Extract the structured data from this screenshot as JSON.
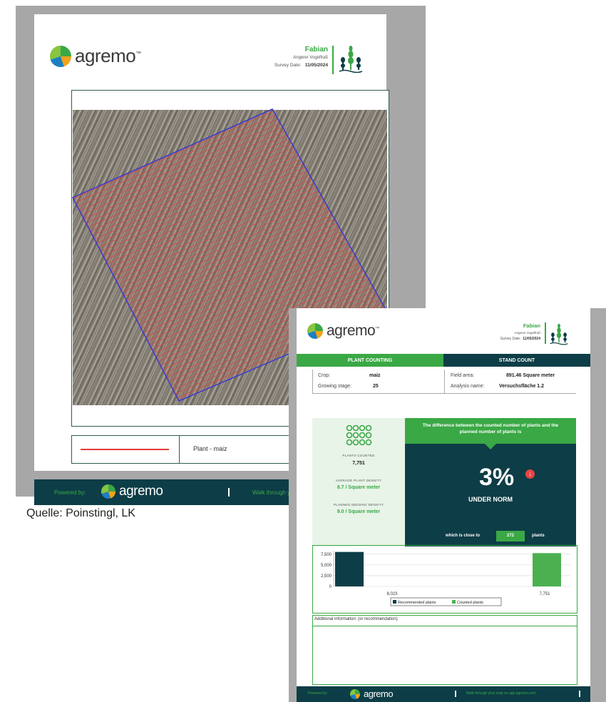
{
  "doc1": {
    "logo_text": "agremo",
    "logo_tm": "™",
    "header": {
      "name": "Fabian",
      "subtitle": "Angerer Vogelfraß",
      "survey_label": "Survey Date:",
      "survey_date": "11/05/2024"
    },
    "legend_label": "Plant - maiz",
    "footer": {
      "powered_by": "Powered by:",
      "logo_text": "agremo",
      "walk": "Walk through your"
    }
  },
  "caption": "Quelle: Poinstingl, LK",
  "doc2": {
    "logo_text": "agremo",
    "logo_tm": "™",
    "header": {
      "name": "Fabian",
      "subtitle": "Angerer Vogelfraß",
      "survey_label": "Survey Date:",
      "survey_date": "11/05/2024"
    },
    "tabs": [
      "PLANT COUNTING",
      "STAND COUNT"
    ],
    "info": {
      "crop_label": "Crop:",
      "crop_value": "maiz",
      "stage_label": "Growing stage:",
      "stage_value": "25",
      "area_label": "Field area:",
      "area_value": "891.46 Square meter",
      "analysis_label": "Analysis name:",
      "analysis_value": "Versuchsfläche 1.2"
    },
    "stats": {
      "plants_counted_label": "PLANTS COUNTED",
      "plants_counted_value": "7,751",
      "avg_density_label": "AVERAGE PLANT DENSITY",
      "avg_density_value": "8.7 / Square meter",
      "planned_density_label": "PLANNED SEEDING DENSITY",
      "planned_density_value": "9.0 / Square meter"
    },
    "difference": {
      "banner": "The difference between the counted number of plants and the planned number of plants is",
      "percent": "3%",
      "status": "UNDER NORM",
      "close_prefix": "which is close to",
      "close_value": "272",
      "close_suffix": "plants"
    },
    "additional_info": "Additional information: (or recommendation)",
    "footer": {
      "powered_by": "Powered by:",
      "logo_text": "agremo",
      "walk": "Walk through your map on app.agremo.com"
    }
  },
  "colors": {
    "green": "#3aa845",
    "navy": "#0d3d46",
    "red": "#e23a3a",
    "field_outline": "#3a3ad0"
  },
  "chart_data": {
    "type": "bar",
    "categories": [
      "8,023",
      "7,751"
    ],
    "values": [
      8023,
      7751
    ],
    "series": [
      {
        "name": "Recommended plants",
        "values": [
          8023,
          null
        ],
        "color": "#0d3d46"
      },
      {
        "name": "Counted plants",
        "values": [
          null,
          7751
        ],
        "color": "#4cb050"
      }
    ],
    "yticks": [
      "7,500",
      "5,000",
      "2,500",
      "0"
    ],
    "ylim": [
      0,
      8300
    ],
    "grid": true,
    "legend": "bottom-center"
  }
}
